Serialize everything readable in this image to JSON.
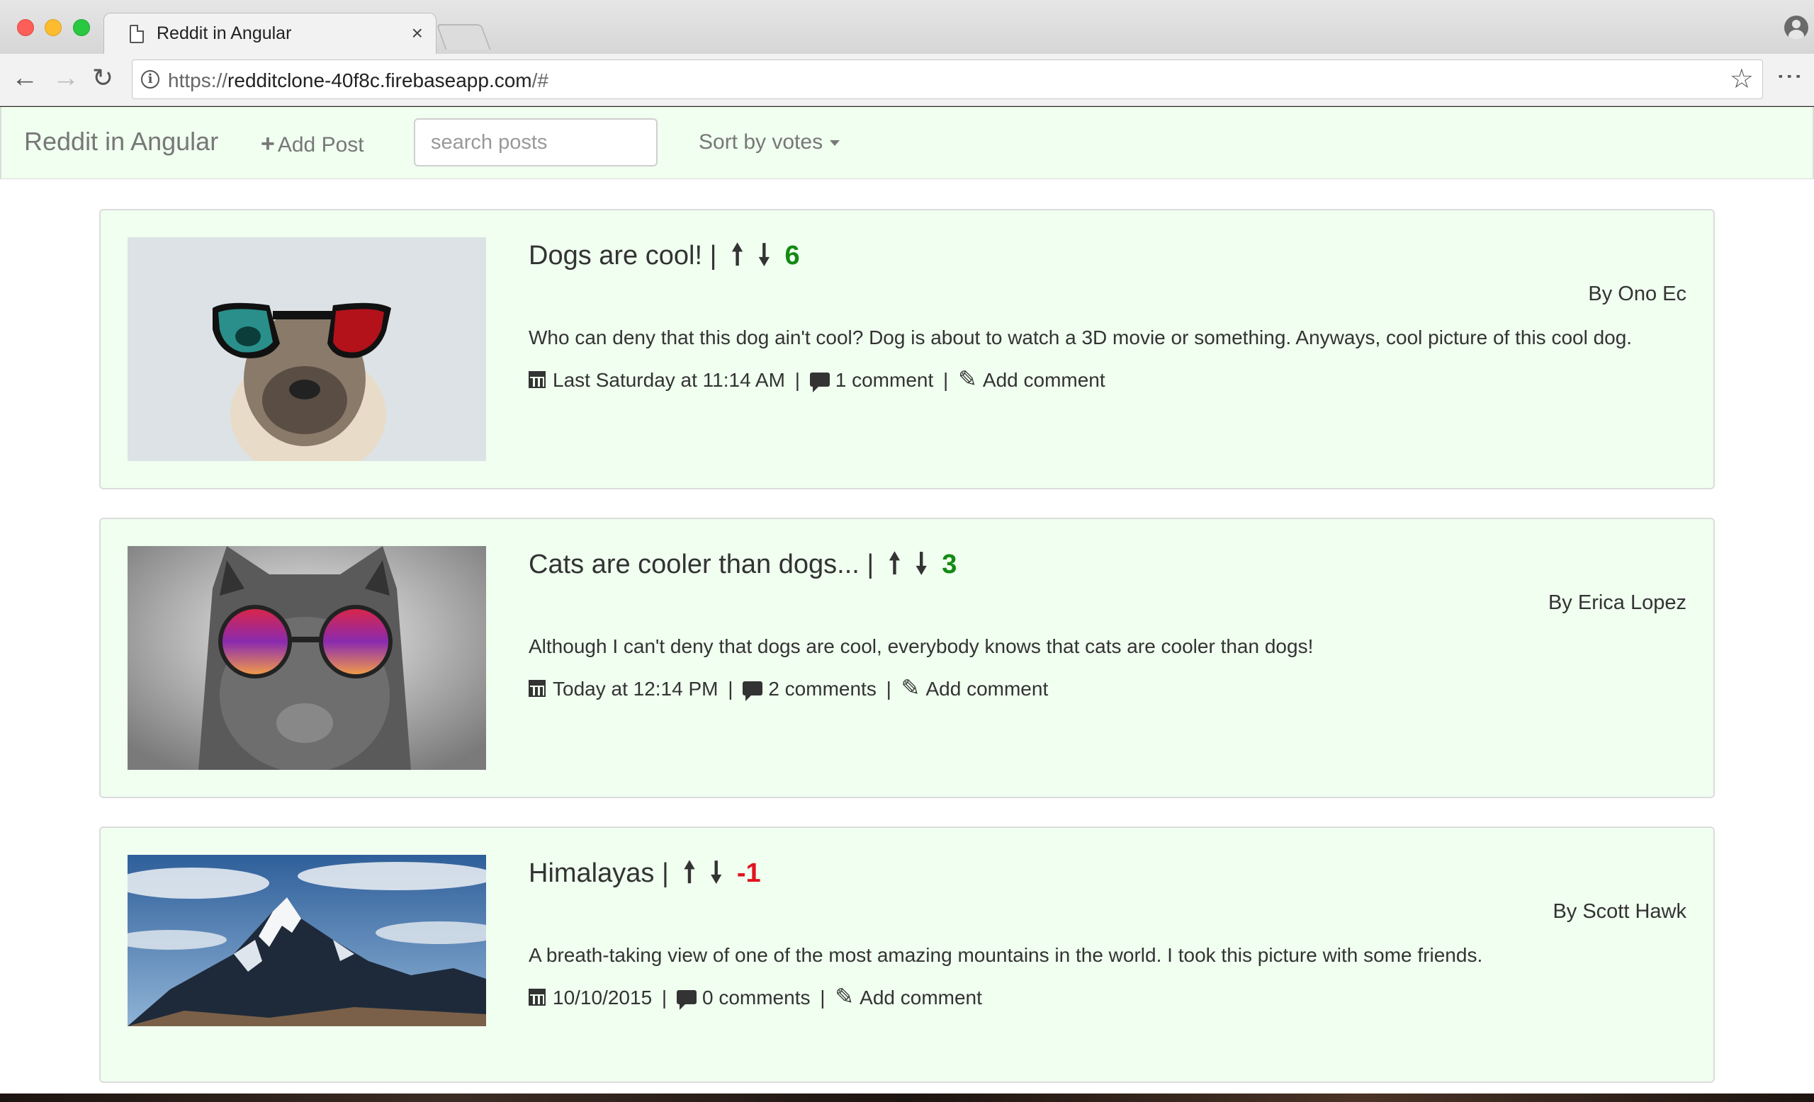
{
  "browser": {
    "tab_title": "Reddit in Angular",
    "tab_close": "×",
    "url_protocol": "https://",
    "url_host": "redditclone-40f8c.firebaseapp.com",
    "url_path": "/#",
    "icons": [
      "page-icon",
      "back-icon",
      "forward-icon",
      "reload-icon",
      "info-icon",
      "star-icon",
      "menu-icon",
      "profile-icon"
    ]
  },
  "navbar": {
    "brand": "Reddit in Angular",
    "add_post_label": "Add Post",
    "search_placeholder": "search posts",
    "sort_label": "Sort by votes"
  },
  "posts": [
    {
      "title": "Dogs are cool!",
      "separator": "|",
      "score": "6",
      "score_color": "#138a13",
      "author": "By Ono Ec",
      "body": "Who can deny that this dog ain't cool? Dog is about to watch a 3D movie or something. Anyways, cool picture of this cool dog.",
      "date": "Last Saturday at 11:14 AM",
      "comments": "1 comment",
      "add_comment": "Add comment",
      "image": "pug-with-3d-glasses"
    },
    {
      "title": "Cats are cooler than dogs...",
      "separator": "|",
      "score": "3",
      "score_color": "#138a13",
      "author": "By Erica Lopez",
      "body": "Although I can't deny that dogs are cool, everybody knows that cats are cooler than dogs!",
      "date": "Today at 12:14 PM",
      "comments": "2 comments",
      "add_comment": "Add comment",
      "image": "cat-with-round-sunglasses"
    },
    {
      "title": "Himalayas",
      "separator": "|",
      "score": "-1",
      "score_color": "#e0141e",
      "author": "By Scott Hawk",
      "body": "A breath-taking view of one of the most amazing mountains in the world. I took this picture with some friends.",
      "date": "10/10/2015",
      "comments": "0 comments",
      "add_comment": "Add comment",
      "image": "snowy-mountain-peak"
    }
  ]
}
